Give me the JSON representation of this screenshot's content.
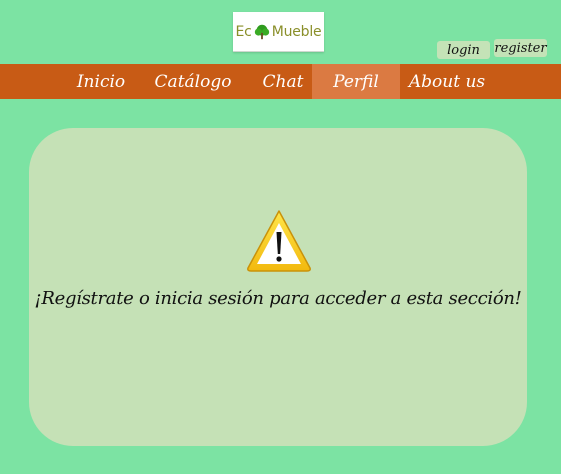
{
  "header": {
    "logo": {
      "text_before": "Ec",
      "text_after": "Mueble",
      "color": "#8a8f2a"
    },
    "auth": {
      "login_label": "login",
      "register_label": "register"
    }
  },
  "nav": {
    "items": [
      {
        "label": "Inicio"
      },
      {
        "label": "Catálogo"
      },
      {
        "label": "Chat"
      },
      {
        "label": "Perfil"
      },
      {
        "label": "About us"
      }
    ],
    "active": "Perfil",
    "bar_color": "#c85b15",
    "active_color": "#db7a42"
  },
  "main": {
    "icon": "warning-icon",
    "message": "¡Regístrate o inicia sesión para acceder a esta sección!"
  },
  "colors": {
    "background": "#7ce3a3",
    "panel": "#c5e1b6",
    "button": "#c4e3b7"
  }
}
